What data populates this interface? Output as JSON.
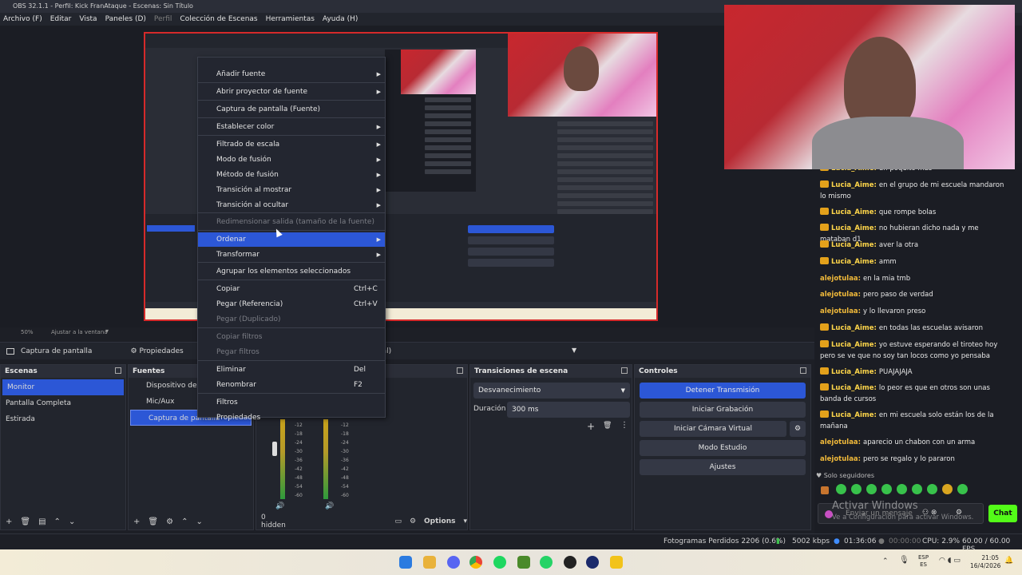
{
  "window": {
    "title": "OBS 32.1.1 - Perfil: Kick FranAtaque - Escenas: Sin Título"
  },
  "menu": [
    "Archivo (F)",
    "Editar",
    "Vista",
    "Paneles (D)",
    "Perfil",
    "Colección de Escenas",
    "Herramientas",
    "Ayuda (H)"
  ],
  "zoombar": {
    "zoom": "50%",
    "fit": "Ajustar a la ventana"
  },
  "source_toolbar": {
    "source_name": "Captura de pantalla",
    "properties": "Propiedades",
    "dropdown_tail": "ncipal)"
  },
  "context_menu": {
    "items": [
      {
        "label": "Añadir fuente"
      },
      {
        "label": "Abrir proyector de fuente"
      },
      {
        "label": "Captura de pantalla (Fuente)"
      },
      {
        "label": "Establecer color"
      },
      {
        "label": "Filtrado de escala"
      },
      {
        "label": "Modo de fusión"
      },
      {
        "label": "Método de fusión"
      },
      {
        "label": "Transición al mostrar"
      },
      {
        "label": "Transición al ocultar"
      },
      {
        "label": "Redimensionar salida (tamaño de la fuente)"
      },
      {
        "label": "Ordenar"
      },
      {
        "label": "Transformar"
      },
      {
        "label": "Agrupar los elementos seleccionados"
      },
      {
        "label": "Copiar",
        "shortcut": "Ctrl+C"
      },
      {
        "label": "Pegar (Referencia)",
        "shortcut": "Ctrl+V"
      },
      {
        "label": "Pegar (Duplicado)"
      },
      {
        "label": "Copiar filtros"
      },
      {
        "label": "Pegar filtros"
      },
      {
        "label": "Eliminar",
        "shortcut": "Del"
      },
      {
        "label": "Renombrar",
        "shortcut": "F2"
      },
      {
        "label": "Filtros"
      },
      {
        "label": "Propiedades"
      }
    ]
  },
  "scenes": {
    "title": "Escenas",
    "items": [
      "Monitor",
      "Pantalla Completa",
      "Estirada"
    ]
  },
  "sources": {
    "title": "Fuentes",
    "items": [
      "Dispositivo de ca",
      "Mic/Aux",
      "Captura de pantalla"
    ]
  },
  "mixer": {
    "hidden": "0 hidden",
    "options": "Options",
    "ticks": [
      "-12",
      "-18",
      "-24",
      "-30",
      "-36",
      "-42",
      "-48",
      "-54",
      "-60"
    ]
  },
  "transitions": {
    "title": "Transiciones de escena",
    "selected": "Desvanecimiento",
    "duration_label": "Duración",
    "duration_value": "300 ms"
  },
  "controls": {
    "title": "Controles",
    "stop_stream": "Detener Transmisión",
    "start_record": "Iniciar Grabación",
    "virtual_cam": "Iniciar Cámara Virtual",
    "studio": "Modo Estudio",
    "settings": "Ajustes"
  },
  "status": {
    "dropped": "Fotogramas Perdidos 2206 (0.6%)",
    "kbps": "5002 kbps",
    "stream_time": "01:36:06",
    "rec_time": "00:00:00",
    "cpu": "CPU: 2.9%",
    "fps": "60.00 / 60.00 FPS"
  },
  "chat": {
    "messages": [
      {
        "user": "Lucia_Aime",
        "text": "un poquito más",
        "crown": true
      },
      {
        "user": "Lucia_Aime",
        "text": "en el grupo de mi escuela mandaron lo mismo",
        "crown": true
      },
      {
        "user": "Lucia_Aime",
        "text": "que rompe bolas",
        "crown": true
      },
      {
        "user": "Lucia_Aime",
        "text": "no hubieran dicho nada y me mataban d1",
        "crown": true
      },
      {
        "user": "Lucia_Aime",
        "text": "aver la otra",
        "crown": true
      },
      {
        "user": "Lucia_Aime",
        "text": "amm",
        "crown": true
      },
      {
        "user": "alejotulaa",
        "text": "en la mia tmb",
        "crown": false
      },
      {
        "user": "alejotulaa",
        "text": "pero paso de verdad",
        "crown": false
      },
      {
        "user": "alejotulaa",
        "text": "y lo llevaron preso",
        "crown": false
      },
      {
        "user": "Lucia_Aime",
        "text": "en todas las escuelas avisaron",
        "crown": true
      },
      {
        "user": "Lucia_Aime",
        "text": "yo estuve esperando el tiroteo hoy pero se ve que no soy tan locos como yo pensaba",
        "crown": true
      },
      {
        "user": "Lucia_Aime",
        "text": "PUAJAJAJA",
        "crown": true
      },
      {
        "user": "Lucia_Aime",
        "text": "lo peor es que en otros son unas banda de cursos",
        "crown": true
      },
      {
        "user": "Lucia_Aime",
        "text": "en mi escuela solo están los de la mañana",
        "crown": true
      },
      {
        "user": "alejotulaa",
        "text": "aparecio un chabon con un arma",
        "crown": false
      },
      {
        "user": "alejotulaa",
        "text": "pero se regalo y lo pararon",
        "crown": false
      }
    ],
    "followers_only": "Solo seguidores",
    "input_placeholder": "Enviar un mensaje",
    "send": "Chat",
    "watermark_title": "Activar Windows",
    "watermark_sub": "Ve a Configuración para activar Windows."
  },
  "tray": {
    "lang": "ESP",
    "lang2": "ES",
    "time": "21:05",
    "date": "16/4/2026"
  },
  "colors": {
    "accent": "#2c57d6",
    "panel": "#22252d",
    "chat_send": "#53fc18"
  }
}
